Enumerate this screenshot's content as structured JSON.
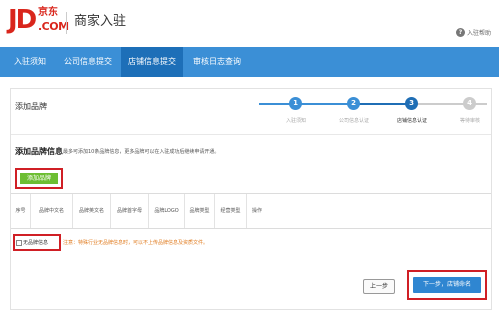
{
  "header": {
    "logo_jd": "JD",
    "logo_cn": "京东",
    "logo_com": ".COM",
    "title": "商家入驻",
    "help_icon": "?",
    "help_label": "入驻帮助"
  },
  "nav": {
    "items": [
      {
        "label": "入驻须知"
      },
      {
        "label": "公司信息提交"
      },
      {
        "label": "店铺信息提交"
      },
      {
        "label": "审核日志查询"
      }
    ],
    "active_index": 2
  },
  "panel": {
    "title": "添加品牌"
  },
  "stepper": {
    "steps": [
      {
        "label": "入驻须知",
        "number": "1"
      },
      {
        "label": "公司信息认证",
        "number": "2"
      },
      {
        "label": "店铺信息认证",
        "number": "3"
      },
      {
        "label": "等待审核",
        "number": "4"
      }
    ],
    "current_index": 2,
    "colors": {
      "done": "#3b8fd6",
      "current": "#1f6eb5",
      "pending": "#cccccc"
    }
  },
  "brand_section": {
    "title": "添加品牌信息",
    "description": "最多可添加10条品牌信息，更多品牌可以在入驻成功后继续申请开通。",
    "add_button": "添加品牌"
  },
  "table": {
    "columns": [
      "序号",
      "品牌中文名",
      "品牌英文名",
      "品牌首字母",
      "品牌LOGO",
      "品牌类型",
      "经营类型",
      "操作"
    ]
  },
  "no_brand": {
    "label": "无品牌信息",
    "checked": false,
    "notice": "注意：特殊行业无品牌信息时，可以不上传品牌信息及资质文件。"
  },
  "actions": {
    "prev_label": "上一步",
    "next_label": "下一步，店铺命名"
  }
}
